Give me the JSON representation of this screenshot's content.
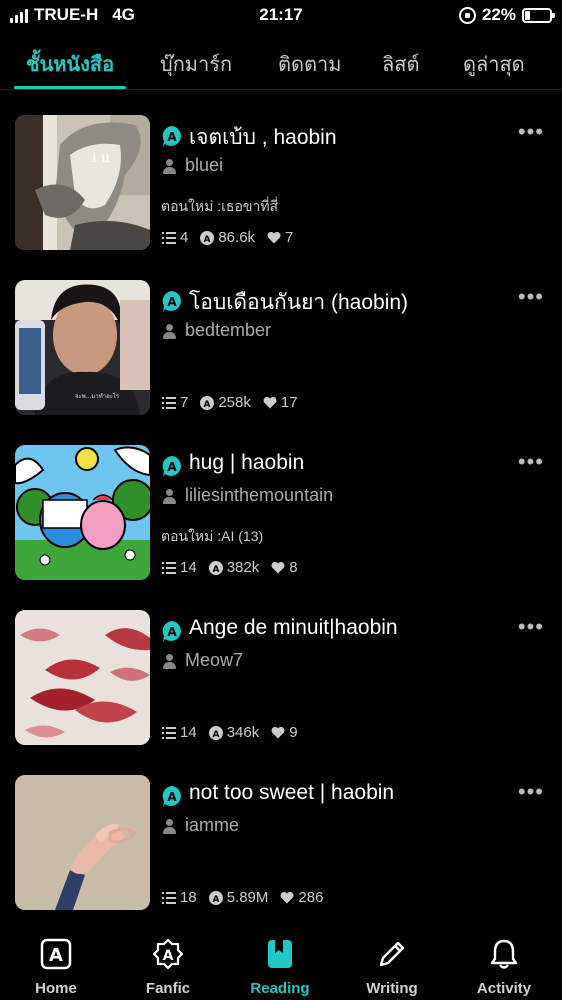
{
  "status_bar": {
    "carrier": "TRUE-H",
    "network": "4G",
    "time": "21:17",
    "battery": "22%",
    "battery_level": 0.22
  },
  "tabs": [
    {
      "label": "ชั้นหนังสือ",
      "active": true
    },
    {
      "label": "บุ๊กมาร์ก",
      "active": false
    },
    {
      "label": "ติดตาม",
      "active": false
    },
    {
      "label": "ลิสต์",
      "active": false
    },
    {
      "label": "ดูล่าสุด",
      "active": false
    }
  ],
  "stories": [
    {
      "title": "เจตเบ้บ , haobin",
      "author": "bluei",
      "update": "ตอนใหม่ :เธอขาที่สี่",
      "chapters": "4",
      "views": "86.6k",
      "likes": "7"
    },
    {
      "title": "โอบเดือนกันยา (haobin)",
      "author": "bedtember",
      "update": "",
      "chapters": "7",
      "views": "258k",
      "likes": "17"
    },
    {
      "title": "hug | haobin",
      "author": "liliesinthemountain",
      "update": "ตอนใหม่ :AI (13)",
      "chapters": "14",
      "views": "382k",
      "likes": "8"
    },
    {
      "title": "Ange de minuit|haobin",
      "author": "Meow7",
      "update": "",
      "chapters": "14",
      "views": "346k",
      "likes": "9"
    },
    {
      "title": "not too sweet | haobin",
      "author": "iamme",
      "update": "",
      "chapters": "18",
      "views": "5.89M",
      "likes": "286"
    }
  ],
  "thumb1_text": "i u",
  "thumb2_text": "จะพ...มาทำอะไร",
  "nav": [
    {
      "label": "Home",
      "icon": "home-a-icon",
      "active": false
    },
    {
      "label": "Fanfic",
      "icon": "fanfic-badge-icon",
      "active": false
    },
    {
      "label": "Reading",
      "icon": "bookmark-book-icon",
      "active": true
    },
    {
      "label": "Writing",
      "icon": "pencil-icon",
      "active": false
    },
    {
      "label": "Activity",
      "icon": "bell-icon",
      "active": false
    }
  ],
  "colors": {
    "accent": "#21c7c2",
    "background": "#000000"
  }
}
